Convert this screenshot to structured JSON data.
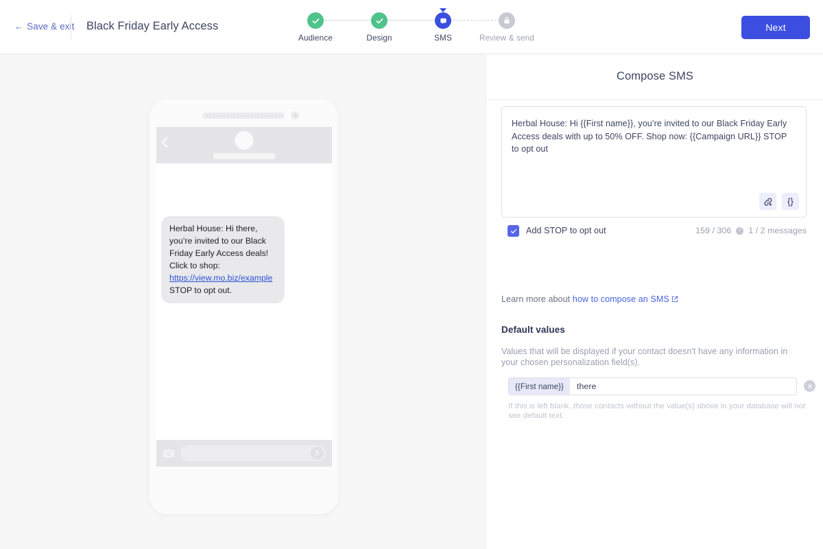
{
  "topbar": {
    "save_exit_label": "Save & exit",
    "back_arrow": "←",
    "campaign_title": "Black Friday Early Access",
    "next_label": "Next"
  },
  "stepper": {
    "steps": [
      {
        "label": "Audience",
        "state": "done",
        "icon": "check-icon"
      },
      {
        "label": "Design",
        "state": "done",
        "icon": "check-icon"
      },
      {
        "label": "SMS",
        "state": "current",
        "icon": "speech-bubble-icon"
      },
      {
        "label": "Review & send",
        "state": "locked",
        "icon": "lock-icon"
      }
    ],
    "colors": {
      "done": "#4fc38a",
      "current": "#3b4ee0",
      "locked": "#c7cad3"
    }
  },
  "preview": {
    "message_prefix": "Herbal House: Hi there, you’re invited to our Black Friday Early Access deals! Click to shop: ",
    "message_link": "https://view.mo.biz/example",
    "message_suffix": " STOP to opt out.",
    "camera_icon": "camera-icon",
    "mic_icon": "microphone-icon",
    "back_icon": "back-chevron-icon"
  },
  "compose": {
    "title": "Compose SMS",
    "body": "Herbal House: Hi {{First name}}, you’re invited to our Black Friday Early Access deals with up to 50% OFF. Shop now: {{Campaign URL}} STOP to opt out",
    "tools": [
      {
        "name": "insert-link-icon",
        "label": "link-plus"
      },
      {
        "name": "merge-tag-icon",
        "label": "{}"
      }
    ],
    "stop_checkbox_label": "Add STOP to opt out",
    "stop_checkbox_checked": true,
    "character_count": "159 / 306",
    "message_count": "1 / 2 messages",
    "info_icon": "info-icon",
    "learn_more_prefix": "Learn more about",
    "learn_more_link": "how to compose an SMS",
    "external_link_icon": "external-link-icon"
  },
  "default_values": {
    "title": "Default values",
    "description": "Values that will be displayed if your contact doesn't have any information in your chosen personalization field(s).",
    "rows": [
      {
        "tag": "{{First name}}",
        "value": "there",
        "placeholder": "",
        "remove_icon": "remove-circle-icon"
      }
    ],
    "help_text": "If this is left blank, those contacts without the value(s) above in your database will not see default text."
  }
}
